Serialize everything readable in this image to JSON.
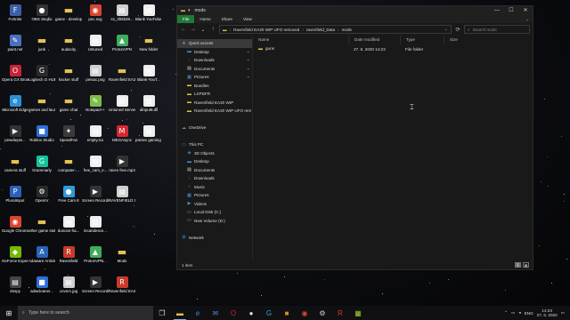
{
  "desktop": {
    "icons": [
      {
        "label": "Fortnite",
        "icon": "fortnite-icon",
        "color": "#3d5fa8",
        "glyph": "F"
      },
      {
        "label": "OBS Studio",
        "icon": "obs-icon",
        "color": "#333333",
        "glyph": "●"
      },
      {
        "label": "game - development",
        "icon": "folder-icon",
        "color": "#e5c24f",
        "glyph": "▬"
      },
      {
        "label": "pec.svg",
        "icon": "chrome-icon",
        "color": "#d9452f",
        "glyph": "◉"
      },
      {
        "label": "ss_3b5b39...",
        "icon": "image-file-icon",
        "color": "#cfcfcf",
        "glyph": "▤"
      },
      {
        "label": "Blank YouTube B...",
        "icon": "file-icon",
        "color": "#eeeeee",
        "glyph": "▤"
      },
      {
        "label": "paint.net",
        "icon": "paintnet-icon",
        "color": "#4a6fbf",
        "glyph": "✎"
      },
      {
        "label": "junk",
        "icon": "folder-icon",
        "color": "#e5c24f",
        "glyph": "▬"
      },
      {
        "label": "audacity",
        "icon": "folder-icon",
        "color": "#e5c24f",
        "glyph": "▬"
      },
      {
        "label": "Untuned",
        "icon": "file-icon",
        "color": "#eeeeee",
        "glyph": "▤"
      },
      {
        "label": "ProtonVPN",
        "icon": "protonvpn-icon",
        "color": "#3fae5a",
        "glyph": "▲"
      },
      {
        "label": "New folder",
        "icon": "folder-icon",
        "color": "#e5c24f",
        "glyph": "▬"
      },
      {
        "label": "Opera GX Browser",
        "icon": "opera-icon",
        "color": "#c8233a",
        "glyph": "O"
      },
      {
        "label": "Logitech G HUB",
        "icon": "logitech-icon",
        "color": "#2a2a2a",
        "glyph": "G"
      },
      {
        "label": "hacker stuff",
        "icon": "folder-icon",
        "color": "#e5c24f",
        "glyph": "▬"
      },
      {
        "label": "peisac.png",
        "icon": "image-file-icon",
        "color": "#cfcfcf",
        "glyph": "▤"
      },
      {
        "label": "Ravenfield EA20 WIP",
        "icon": "folder-icon",
        "color": "#e5c24f",
        "glyph": "▬"
      },
      {
        "label": "Blank-YouT...",
        "icon": "file-icon",
        "color": "#eeeeee",
        "glyph": "▤"
      },
      {
        "label": "Microsoft Edge",
        "icon": "edge-icon",
        "color": "#2d8fd5",
        "glyph": "e"
      },
      {
        "label": "games and launchers",
        "icon": "folder-icon",
        "color": "#e5c24f",
        "glyph": "▬"
      },
      {
        "label": "game chat",
        "icon": "folder-icon",
        "color": "#e5c24f",
        "glyph": "▬"
      },
      {
        "label": "Notepad++",
        "icon": "notepadpp-icon",
        "color": "#7dbf4a",
        "glyph": "✎"
      },
      {
        "label": "Untuned Server",
        "icon": "file-icon",
        "color": "#eeeeee",
        "glyph": "▤"
      },
      {
        "label": "dinput8.dll",
        "icon": "file-icon",
        "color": "#eeeeee",
        "glyph": "▤"
      },
      {
        "label": "pewdiepie...",
        "icon": "video-file-icon",
        "color": "#333333",
        "glyph": "▶"
      },
      {
        "label": "Roblox Studio",
        "icon": "roblox-icon",
        "color": "#2e6fd8",
        "glyph": "■"
      },
      {
        "label": "SpeedFan",
        "icon": "speedfan-icon",
        "color": "#3a3a3a",
        "glyph": "✦"
      },
      {
        "label": "empty.ico",
        "icon": "file-icon",
        "color": "#eeeeee",
        "glyph": "▤"
      },
      {
        "label": "MEGAsync",
        "icon": "mega-icon",
        "color": "#d9272e",
        "glyph": "M"
      },
      {
        "label": "parsec gaming pass",
        "icon": "file-icon",
        "color": "#eeeeee",
        "glyph": "▤"
      },
      {
        "label": "camera stuff",
        "icon": "folder-icon",
        "color": "#e5c24f",
        "glyph": "▬"
      },
      {
        "label": "Grammarly",
        "icon": "grammarly-icon",
        "color": "#15c39a",
        "glyph": "G"
      },
      {
        "label": "computer-...",
        "icon": "folder-icon",
        "color": "#e5c24f",
        "glyph": "▬"
      },
      {
        "label": "free_cam_e...",
        "icon": "file-icon",
        "color": "#eeeeee",
        "glyph": "▤"
      },
      {
        "label": "raven free.mp4",
        "icon": "video-file-icon",
        "color": "#333333",
        "glyph": "▶"
      },
      {
        "label": "",
        "icon": "blank",
        "color": "transparent",
        "glyph": ""
      },
      {
        "label": "PluralInput",
        "icon": "pluralinput-icon",
        "color": "#2a62b8",
        "glyph": "P"
      },
      {
        "label": "OpenIV",
        "icon": "openiv-icon",
        "color": "#2a2a2a",
        "glyph": "⚙"
      },
      {
        "label": "Free Cam 8",
        "icon": "freecam-icon",
        "color": "#2e9bd8",
        "glyph": "●"
      },
      {
        "label": "Screen Recordin...",
        "icon": "video-file-icon",
        "color": "#333333",
        "glyph": "▶"
      },
      {
        "label": "RAVENFIELD SFE.jpg",
        "icon": "image-file-icon",
        "color": "#cfcfcf",
        "glyph": "▤"
      },
      {
        "label": "",
        "icon": "blank",
        "color": "transparent",
        "glyph": ""
      },
      {
        "label": "Google Chrome",
        "icon": "chrome-icon",
        "color": "#d9452f",
        "glyph": "◉"
      },
      {
        "label": "other game stuff",
        "icon": "folder-icon",
        "color": "#e5c24f",
        "glyph": "▬"
      },
      {
        "label": "duncan-ha...",
        "icon": "file-icon",
        "color": "#eeeeee",
        "glyph": "▤"
      },
      {
        "label": "incandesce...",
        "icon": "file-icon",
        "color": "#eeeeee",
        "glyph": "▤"
      },
      {
        "label": "",
        "icon": "blank",
        "color": "transparent",
        "glyph": ""
      },
      {
        "label": "",
        "icon": "blank",
        "color": "transparent",
        "glyph": ""
      },
      {
        "label": "GeForce Experience",
        "icon": "geforce-icon",
        "color": "#76b900",
        "glyph": "◆"
      },
      {
        "label": "Adaware Antivirus",
        "icon": "adaware-icon",
        "color": "#2a62b8",
        "glyph": "A"
      },
      {
        "label": "Ravenfield",
        "icon": "ravenfield-icon",
        "color": "#c83b2a",
        "glyph": "R"
      },
      {
        "label": "ProtonVPN...",
        "icon": "protonvpn-icon",
        "color": "#3fae5a",
        "glyph": "▲"
      },
      {
        "label": "Mods",
        "icon": "folder-icon",
        "color": "#e5c24f",
        "glyph": "▬"
      },
      {
        "label": "",
        "icon": "blank",
        "color": "transparent",
        "glyph": ""
      },
      {
        "label": "dnspy",
        "icon": "dnspy-icon",
        "color": "#444444",
        "glyph": "▤"
      },
      {
        "label": "adwcleaner...",
        "icon": "adwcleaner-icon",
        "color": "#2e6fd8",
        "glyph": "■"
      },
      {
        "label": "cover1.jpg",
        "icon": "image-file-icon",
        "color": "#cfcfcf",
        "glyph": "▤"
      },
      {
        "label": "Screen Recordin...",
        "icon": "video-file-icon",
        "color": "#333333",
        "glyph": "▶"
      },
      {
        "label": "Ravenfield EA20 WIP",
        "icon": "ravenfield-icon",
        "color": "#c83b2a",
        "glyph": "R"
      },
      {
        "label": "",
        "icon": "blank",
        "color": "transparent",
        "glyph": ""
      }
    ]
  },
  "window": {
    "title": "mods",
    "controls": {
      "minimize": "—",
      "maximize": "☐",
      "close": "✕"
    },
    "ribbon": {
      "file": "File",
      "home": "Home",
      "share": "Share",
      "view": "View",
      "expand": "⌄"
    },
    "nav": {
      "back": "←",
      "forward": "→",
      "recent": "⌄",
      "up": "↑",
      "refresh": "⟳"
    },
    "address": {
      "segments": [
        "Ravenfield EA20 WIP UFO removed",
        "ravenfield_Data",
        "mods"
      ],
      "separator": "›"
    },
    "search": {
      "placeholder": "Search mods"
    },
    "sidebar": [
      {
        "label": "Quick access",
        "icon": "star-icon",
        "glyph": "★",
        "color": "#5aa0e6",
        "pinned": false,
        "selected": true
      },
      {
        "label": "Desktop",
        "icon": "desktop-icon",
        "glyph": "▬",
        "color": "#4a8fd8",
        "pinned": true,
        "selected": false
      },
      {
        "label": "Downloads",
        "icon": "downloads-icon",
        "glyph": "↓",
        "color": "#4a8fd8",
        "pinned": true,
        "selected": false
      },
      {
        "label": "Documents",
        "icon": "documents-icon",
        "glyph": "▤",
        "color": "#cfcfcf",
        "pinned": true,
        "selected": false
      },
      {
        "label": "Pictures",
        "icon": "pictures-icon",
        "glyph": "▦",
        "color": "#4a8fd8",
        "pinned": true,
        "selected": false
      },
      {
        "label": "Bundles",
        "icon": "folder-icon",
        "glyph": "▬",
        "color": "#e5c24f",
        "pinned": false,
        "selected": false
      },
      {
        "label": "LSPDFR",
        "icon": "folder-icon",
        "glyph": "▬",
        "color": "#e5c24f",
        "pinned": false,
        "selected": false
      },
      {
        "label": "Ravenfield EA20 WIP",
        "icon": "folder-icon",
        "glyph": "▬",
        "color": "#e5c24f",
        "pinned": false,
        "selected": false
      },
      {
        "label": "Ravenfield EA20 WIP UFO rem",
        "icon": "folder-icon",
        "glyph": "▬",
        "color": "#e5c24f",
        "pinned": false,
        "selected": false
      },
      {
        "label": "",
        "icon": "blank",
        "glyph": "",
        "color": "transparent",
        "pinned": false,
        "selected": false
      },
      {
        "label": "OneDrive",
        "icon": "onedrive-icon",
        "glyph": "☁",
        "color": "#4a8fd8",
        "pinned": false,
        "selected": false
      },
      {
        "label": "",
        "icon": "blank",
        "glyph": "",
        "color": "transparent",
        "pinned": false,
        "selected": false
      },
      {
        "label": "This PC",
        "icon": "this-pc-icon",
        "glyph": "▭",
        "color": "#4a8fd8",
        "pinned": false,
        "selected": false
      },
      {
        "label": "3D Objects",
        "icon": "3d-objects-icon",
        "glyph": "◈",
        "color": "#4a8fd8",
        "pinned": false,
        "selected": false
      },
      {
        "label": "Desktop",
        "icon": "desktop-icon",
        "glyph": "▬",
        "color": "#4a8fd8",
        "pinned": false,
        "selected": false
      },
      {
        "label": "Documents",
        "icon": "documents-icon",
        "glyph": "▤",
        "color": "#cfcfcf",
        "pinned": false,
        "selected": false
      },
      {
        "label": "Downloads",
        "icon": "downloads-icon",
        "glyph": "↓",
        "color": "#4a8fd8",
        "pinned": false,
        "selected": false
      },
      {
        "label": "Music",
        "icon": "music-icon",
        "glyph": "♪",
        "color": "#4a8fd8",
        "pinned": false,
        "selected": false
      },
      {
        "label": "Pictures",
        "icon": "pictures-icon",
        "glyph": "▦",
        "color": "#4a8fd8",
        "pinned": false,
        "selected": false
      },
      {
        "label": "Videos",
        "icon": "videos-icon",
        "glyph": "▶",
        "color": "#4a8fd8",
        "pinned": false,
        "selected": false
      },
      {
        "label": "Local Disk (C:)",
        "icon": "disk-icon",
        "glyph": "▭",
        "color": "#9aa0a6",
        "pinned": false,
        "selected": false
      },
      {
        "label": "New Volume (D:)",
        "icon": "disk-icon",
        "glyph": "▭",
        "color": "#9aa0a6",
        "pinned": false,
        "selected": false
      },
      {
        "label": "",
        "icon": "blank",
        "glyph": "",
        "color": "transparent",
        "pinned": false,
        "selected": false
      },
      {
        "label": "Network",
        "icon": "network-icon",
        "glyph": "⊞",
        "color": "#4a8fd8",
        "pinned": false,
        "selected": false
      }
    ],
    "columns": {
      "name": "Name",
      "date": "Date modified",
      "type": "Type",
      "size": "Size"
    },
    "files": [
      {
        "name": "guns",
        "date": "27. 6. 2020 14:23",
        "type": "File folder",
        "size": ""
      }
    ],
    "status": {
      "count": "1 item",
      "details_view": "≣",
      "icons_view": "▦"
    }
  },
  "taskbar": {
    "start": "⊞",
    "search_placeholder": "Type here to search",
    "apps": [
      {
        "name": "task-view-icon",
        "glyph": "❐",
        "color": "#dddddd",
        "active": false
      },
      {
        "name": "file-explorer-icon",
        "glyph": "▬",
        "color": "#e5c24f",
        "active": true
      },
      {
        "name": "edge-icon",
        "glyph": "e",
        "color": "#2d8fd5",
        "active": false
      },
      {
        "name": "mail-icon",
        "glyph": "✉",
        "color": "#4a8fd8",
        "active": false
      },
      {
        "name": "opera-icon",
        "glyph": "O",
        "color": "#c8233a",
        "active": false
      },
      {
        "name": "obs-icon",
        "glyph": "●",
        "color": "#dddddd",
        "active": false
      },
      {
        "name": "logitech-icon",
        "glyph": "G",
        "color": "#3aa0e0",
        "active": false
      },
      {
        "name": "game-icon",
        "glyph": "■",
        "color": "#d98a2e",
        "active": false
      },
      {
        "name": "chrome-icon",
        "glyph": "◉",
        "color": "#d9452f",
        "active": false
      },
      {
        "name": "steam-icon",
        "glyph": "⚙",
        "color": "#cfcfcf",
        "active": false
      },
      {
        "name": "ravenfield-icon",
        "glyph": "R",
        "color": "#c83b2a",
        "active": false
      },
      {
        "name": "image-viewer-icon",
        "glyph": "▦",
        "color": "#9acd32",
        "active": false
      }
    ],
    "tray": {
      "chevron": "⌃",
      "lang": "ENG",
      "time": "14:23",
      "date": "27. 6. 2020",
      "notification": "▭"
    }
  }
}
